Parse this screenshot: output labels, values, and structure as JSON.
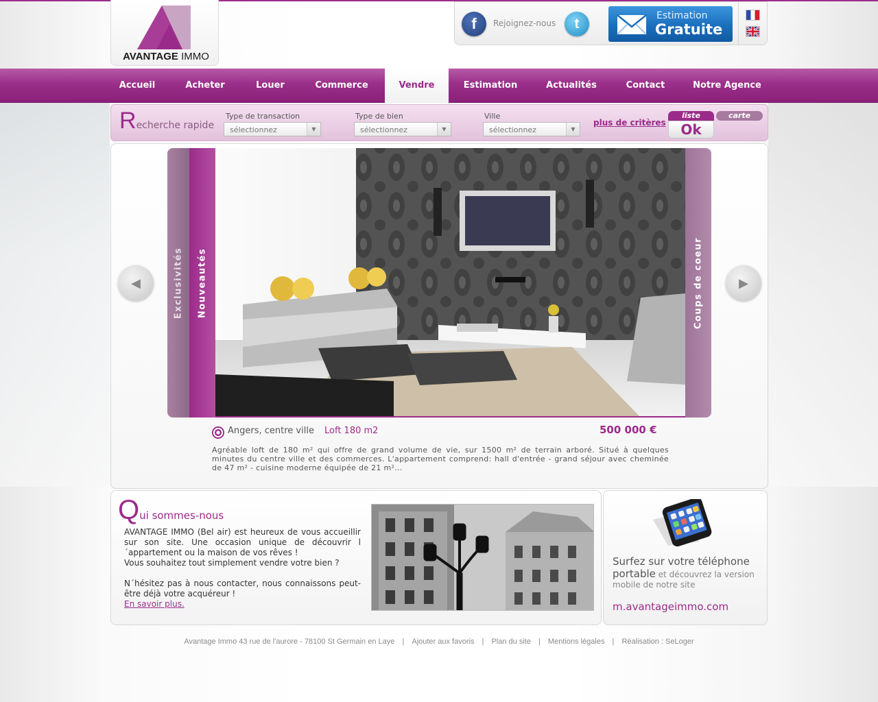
{
  "brand": {
    "name_bold": "AVANTAGE",
    "name_rest": " IMMO",
    "accent": "#9b2b8a"
  },
  "header": {
    "join_label": "Rejoignez-nous",
    "estimation_line1": "Estimation",
    "estimation_line2": "Gratuite",
    "facebook_glyph": "f",
    "twitter_glyph": "t",
    "languages": [
      "fr-flag-icon",
      "uk-flag-icon"
    ]
  },
  "nav": {
    "items": [
      {
        "label": "Accueil"
      },
      {
        "label": "Acheter"
      },
      {
        "label": "Louer"
      },
      {
        "label": "Commerce"
      },
      {
        "label": "Vendre"
      },
      {
        "label": "Estimation"
      },
      {
        "label": "Actualités"
      },
      {
        "label": "Contact"
      },
      {
        "label": "Notre Agence"
      }
    ],
    "active": "Vendre"
  },
  "search": {
    "title_initial": "R",
    "title_rest": "echerche rapide",
    "fields": [
      {
        "label": "Type de transaction",
        "value": "sélectionnez"
      },
      {
        "label": "Type de bien",
        "value": "sélectionnez"
      },
      {
        "label": "Ville",
        "value": "sélectionnez"
      }
    ],
    "more_criteria": "plus de critères",
    "btn_liste": "liste",
    "btn_carte": "carte",
    "btn_ok": "Ok"
  },
  "slider": {
    "tabs": {
      "left1": "Exclusivités",
      "left2": "Nouveautés",
      "right": "Coups de coeur"
    },
    "listing": {
      "city": "Angers, centre ville",
      "type": "Loft 180 m2",
      "price": "500 000 €",
      "description": "Agréable loft de 180 m² qui offre de grand volume de vie, sur 1500 m² de terrain arboré. Situé à quelques minutes du centre ville et des commerces. L'appartement comprend: hall d'entrée - grand séjour avec cheminée de 47 m² - cuisine moderne équipée de 21 m²..."
    }
  },
  "who": {
    "title_initial": "Q",
    "title_rest": "ui sommes-nous",
    "para1": "AVANTAGE IMMO (Bel air) est heureux de vous accueillir sur son site. Une occasion unique de découvrir l´appartement ou la maison de vos rêves !",
    "para2": "Vous souhaitez tout simplement vendre votre bien ?",
    "para3": "N´hésitez pas à nous contacter, nous connaissons peut-être déjà votre acquéreur !",
    "link": "En savoir plus."
  },
  "mobile": {
    "line_strong": "Surfez sur votre téléphone portable",
    "line_rest": " et découvrez la version mobile de notre site",
    "url": "m.avantageimmo.com"
  },
  "footer": {
    "address": "Avantage Immo 43 rue de l'aurore - 78100 St Germain en Laye",
    "sep": "|",
    "favorites": "Ajouter aux favoris",
    "sitemap": "Plan du site",
    "legal": "Mentions légales",
    "credit": "Réalisation : SeLoger"
  }
}
